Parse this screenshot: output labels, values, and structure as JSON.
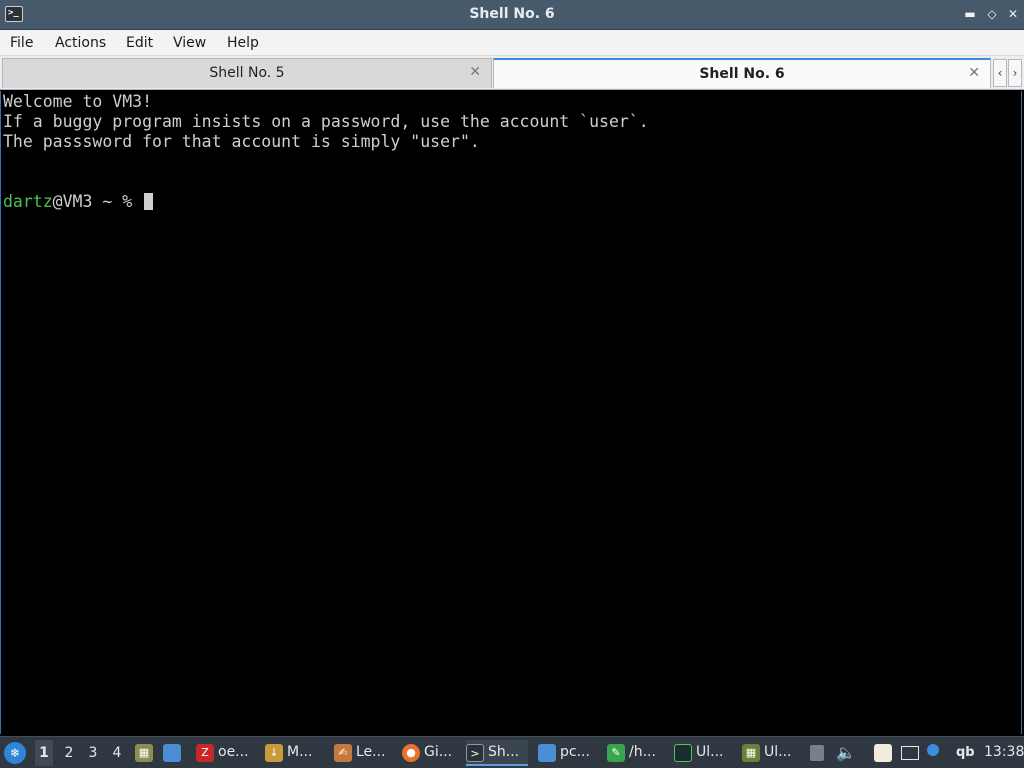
{
  "window": {
    "title": "Shell No. 6",
    "icon": "terminal-icon",
    "buttons": {
      "minimize": "minimize-icon",
      "maximize": "maximize-icon",
      "close": "close-icon"
    }
  },
  "menu": {
    "file": "File",
    "actions": "Actions",
    "edit": "Edit",
    "view": "View",
    "help": "Help"
  },
  "tabs": [
    {
      "label": "Shell No. 5",
      "active": false
    },
    {
      "label": "Shell No. 6",
      "active": true
    }
  ],
  "terminal": {
    "lines": [
      "Welcome to VM3!",
      "If a buggy program insists on a password, use the account `user`.",
      "The passsword for that account is simply \"user\"."
    ],
    "prompt_user": "dartz",
    "prompt_rest": "@VM3 ~ % "
  },
  "taskbar": {
    "workspaces": [
      "1",
      "2",
      "3",
      "4"
    ],
    "active_workspace": "1",
    "tasks": [
      {
        "label": "oe...",
        "icon": "filezilla-icon",
        "color": "#c62828"
      },
      {
        "label": "M...",
        "icon": "download-icon",
        "color": "#c99a3b"
      },
      {
        "label": "Le...",
        "icon": "app-icon",
        "color": "#c47a3c"
      },
      {
        "label": "Gi...",
        "icon": "firefox-icon",
        "color": "#e8712b"
      },
      {
        "label": "Sh...",
        "icon": "terminal-icon",
        "color": "#2b3238"
      },
      {
        "label": "pc...",
        "icon": "folder-icon",
        "color": "#4a8fd6"
      },
      {
        "label": "/h...",
        "icon": "editor-icon",
        "color": "#3aa54a"
      },
      {
        "label": "Ul...",
        "icon": "monitor-icon",
        "color": "#1d2a30"
      },
      {
        "label": "Ul...",
        "icon": "game-icon",
        "color": "#6d7f3a"
      }
    ],
    "tray_qb": "qb",
    "clock": "13:38"
  }
}
